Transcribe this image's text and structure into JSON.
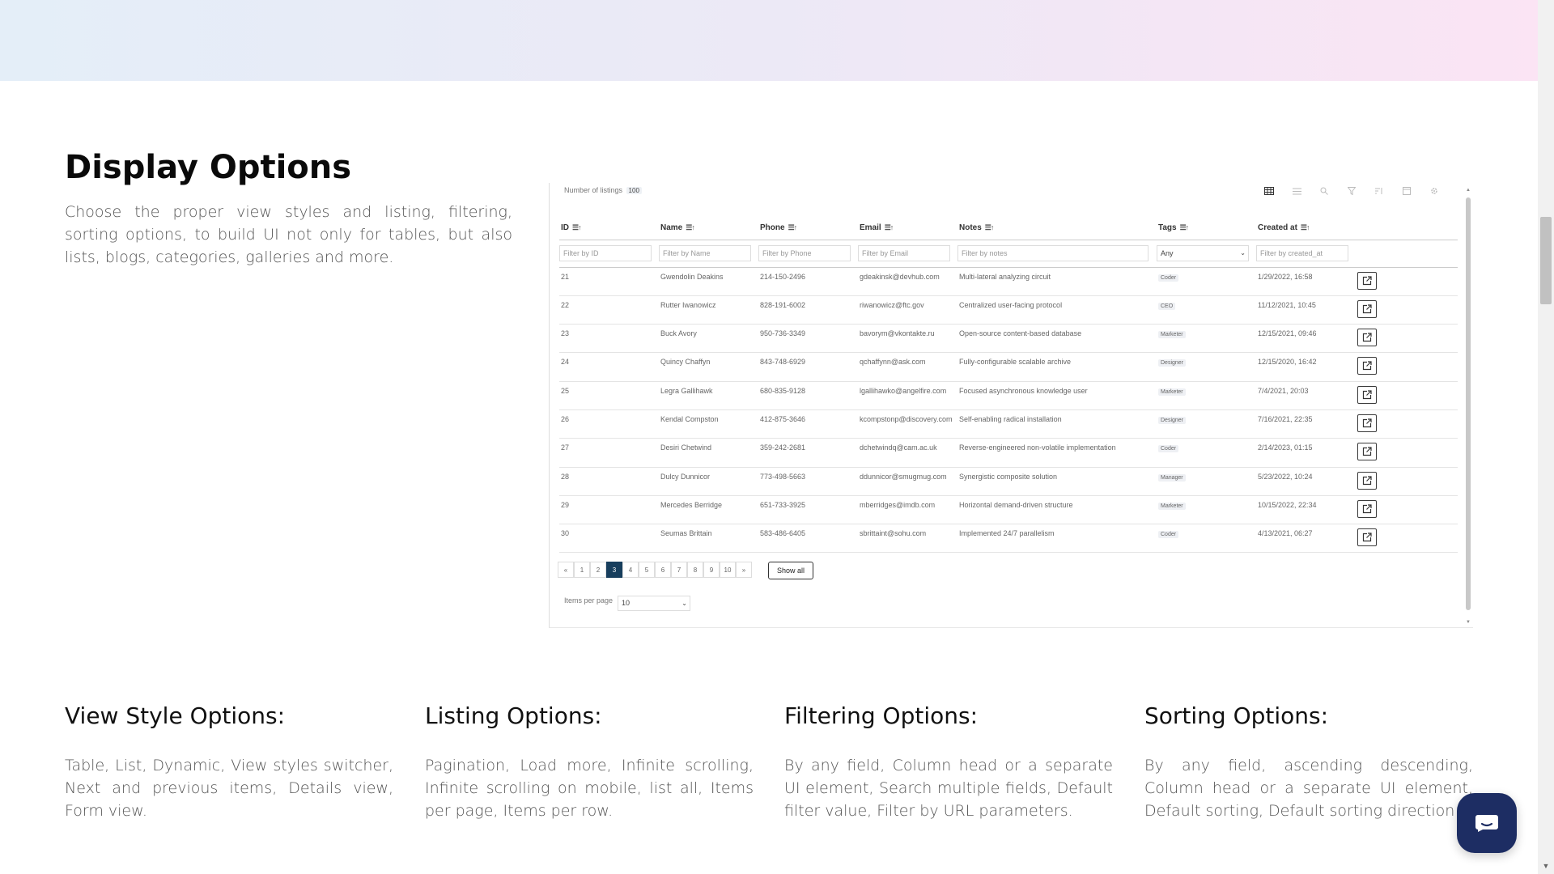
{
  "section": {
    "title": "Display Options",
    "description": "Choose the proper view styles and listing, filtering, sorting options, to build UI not only for tables, but also lists, blogs, categories, galleries and more."
  },
  "preview": {
    "count_label": "Number of listings",
    "count_value": "100",
    "toolbar_icons": [
      "table-view-icon",
      "list-view-icon",
      "search-icon",
      "filter-icon",
      "sort-icon",
      "layout-icon",
      "settings-icon"
    ],
    "columns": [
      "ID",
      "Name",
      "Phone",
      "Email",
      "Notes",
      "Tags",
      "Created at"
    ],
    "filters": {
      "id": "Filter by ID",
      "name": "Filter by Name",
      "phone": "Filter by Phone",
      "email": "Filter by Email",
      "notes": "Filter by notes",
      "tags": "Any",
      "created": "Filter by created_at"
    },
    "rows": [
      {
        "id": "21",
        "name": "Gwendolin Deakins",
        "phone": "214-150-2496",
        "email": "gdeakinsk@devhub.com",
        "notes": "Multi-lateral analyzing circuit",
        "tag": "Coder",
        "created": "1/29/2022, 16:58"
      },
      {
        "id": "22",
        "name": "Rutter Iwanowicz",
        "phone": "828-191-6002",
        "email": "riwanowicz@ftc.gov",
        "notes": "Centralized user-facing protocol",
        "tag": "CEO",
        "created": "11/12/2021, 10:45"
      },
      {
        "id": "23",
        "name": "Buck Avory",
        "phone": "950-736-3349",
        "email": "bavorym@vkontakte.ru",
        "notes": "Open-source content-based database",
        "tag": "Marketer",
        "created": "12/15/2021, 09:46"
      },
      {
        "id": "24",
        "name": "Quincy Chaffyn",
        "phone": "843-748-6929",
        "email": "qchaffynn@ask.com",
        "notes": "Fully-configurable scalable archive",
        "tag": "Designer",
        "created": "12/15/2020, 16:42"
      },
      {
        "id": "25",
        "name": "Legra Gallihawk",
        "phone": "680-835-9128",
        "email": "lgallihawko@angelfire.com",
        "notes": "Focused asynchronous knowledge user",
        "tag": "Marketer",
        "created": "7/4/2021, 20:03"
      },
      {
        "id": "26",
        "name": "Kendal Compston",
        "phone": "412-875-3646",
        "email": "kcompstonp@discovery.com",
        "notes": "Self-enabling radical installation",
        "tag": "Designer",
        "created": "7/16/2021, 22:35"
      },
      {
        "id": "27",
        "name": "Desiri Chetwind",
        "phone": "359-242-2681",
        "email": "dchetwindq@cam.ac.uk",
        "notes": "Reverse-engineered non-volatile implementation",
        "tag": "Coder",
        "created": "2/14/2023, 01:15"
      },
      {
        "id": "28",
        "name": "Dulcy Dunnicor",
        "phone": "773-498-5663",
        "email": "ddunnicor@smugmug.com",
        "notes": "Synergistic composite solution",
        "tag": "Manager",
        "created": "5/23/2022, 10:24"
      },
      {
        "id": "29",
        "name": "Mercedes Berridge",
        "phone": "651-733-3925",
        "email": "mberridges@imdb.com",
        "notes": "Horizontal demand-driven structure",
        "tag": "Marketer",
        "created": "10/15/2022, 22:34"
      },
      {
        "id": "30",
        "name": "Seumas Brittain",
        "phone": "583-486-6405",
        "email": "sbrittaint@sohu.com",
        "notes": "Implemented 24/7 parallelism",
        "tag": "Coder",
        "created": "4/13/2021, 06:27"
      }
    ],
    "pagination": {
      "prev": "«",
      "next": "»",
      "pages": [
        "1",
        "2",
        "3",
        "4",
        "5",
        "6",
        "7",
        "8",
        "9",
        "10"
      ],
      "current": "3",
      "show_all": "Show all"
    },
    "items_per_page_label": "Items per page",
    "items_per_page_value": "10"
  },
  "options": [
    {
      "title": "View Style Options:",
      "text": "Table, List, Dynamic, View styles switcher, Next and previous items, Details view, Form view."
    },
    {
      "title": "Listing Options:",
      "text": "Pagination, Load more, Infinite scrolling, Infinite scrolling on mobile, list all, Items per page, Items per row."
    },
    {
      "title": "Filtering Options:",
      "text": "By any field, Column head or a separate UI element, Search multiple fields, Default filter value, Filter by URL parameters."
    },
    {
      "title": "Sorting Options:",
      "text": "By any field, ascending descending, Column head or a separate UI element, Default sorting, Default sorting direction"
    }
  ],
  "colors": {
    "pager_active": "#173e5d",
    "chat_bubble": "#1d2d63"
  }
}
